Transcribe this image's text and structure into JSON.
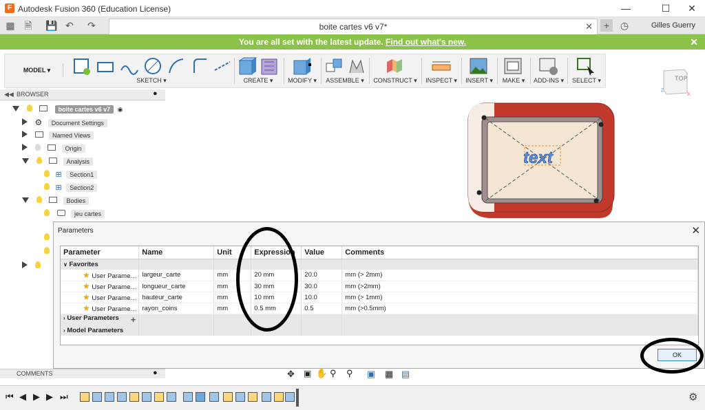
{
  "app": {
    "title": "Autodesk Fusion 360 (Education License)",
    "user": "Gilles Guerry",
    "logo": "F"
  },
  "tab": {
    "name": "boite cartes v6 v7*"
  },
  "banner": {
    "text": "You are all set with the latest update.",
    "link": "Find out what's new."
  },
  "toolbar": {
    "workspace": "MODEL",
    "groups": [
      {
        "id": "sketch",
        "label": "SKETCH"
      },
      {
        "id": "create",
        "label": "CREATE"
      },
      {
        "id": "modify",
        "label": "MODIFY"
      },
      {
        "id": "assemble",
        "label": "ASSEMBLE"
      },
      {
        "id": "construct",
        "label": "CONSTRUCT"
      },
      {
        "id": "inspect",
        "label": "INSPECT"
      },
      {
        "id": "insert",
        "label": "INSERT"
      },
      {
        "id": "make",
        "label": "MAKE"
      },
      {
        "id": "addins",
        "label": "ADD-INS"
      },
      {
        "id": "select",
        "label": "SELECT"
      }
    ]
  },
  "viewcube": {
    "label": "TOP"
  },
  "browser": {
    "title": "BROWSER",
    "root": "boite cartes v6 v7",
    "items": [
      {
        "label": "Document Settings"
      },
      {
        "label": "Named Views"
      },
      {
        "label": "Origin"
      },
      {
        "label": "Analysis"
      },
      {
        "label": "Section1"
      },
      {
        "label": "Section2"
      },
      {
        "label": "Bodies"
      },
      {
        "label": "jeu cartes"
      }
    ]
  },
  "viewport": {
    "model_text": "text"
  },
  "dialog": {
    "title": "Parameters",
    "columns": [
      "Parameter",
      "Name",
      "Unit",
      "Expression",
      "Value",
      "Comments"
    ],
    "favorites_label": "Favorites",
    "rows": [
      {
        "param": "User Parame...",
        "name": "largeur_carte",
        "unit": "mm",
        "expr": "20 mm",
        "value": "20.0",
        "comment": "mm (> 2mm)"
      },
      {
        "param": "User Parame...",
        "name": "longueur_carte",
        "unit": "mm",
        "expr": "30 mm",
        "value": "30.0",
        "comment": "mm (>2mm)"
      },
      {
        "param": "User Parame...",
        "name": "hauteur_carte",
        "unit": "mm",
        "expr": "10 mm",
        "value": "10.0",
        "comment": "mm (> 1mm)"
      },
      {
        "param": "User Parame...",
        "name": "rayon_coins",
        "unit": "mm",
        "expr": "0.5 mm",
        "value": "0.5",
        "comment": "mm (>0.5mm)"
      }
    ],
    "user_params_label": "User Parameters",
    "model_params_label": "Model Parameters",
    "ok": "OK"
  },
  "comments": {
    "label": "COMMENTS"
  }
}
